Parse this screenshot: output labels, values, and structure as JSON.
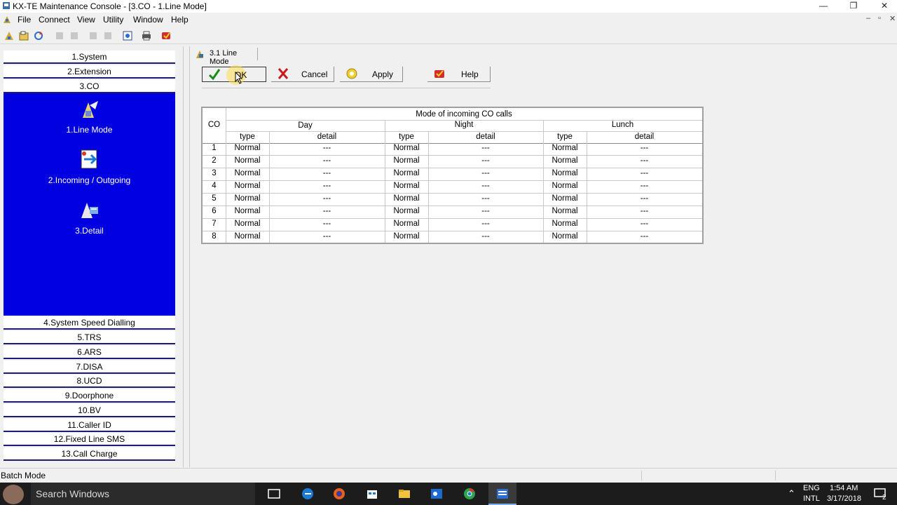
{
  "window": {
    "title": "KX-TE Maintenance Console - [3.CO - 1.Line Mode]",
    "controls": [
      "—",
      "❐",
      "✕"
    ]
  },
  "menubar": {
    "items": [
      "File",
      "Connect",
      "View",
      "Utility",
      "Window",
      "Help"
    ],
    "mdi_controls": [
      "–",
      "▫",
      "✕"
    ]
  },
  "leftnav": {
    "top_items": [
      "1.System",
      "2.Extension",
      "3.CO"
    ],
    "sub_items": [
      "1.Line Mode",
      "2.Incoming / Outgoing",
      "3.Detail"
    ],
    "bottom_items": [
      "4.System Speed Dialling",
      "5.TRS",
      "6.ARS",
      "7.DISA",
      "8.UCD",
      "9.Doorphone",
      "10.BV",
      "11.Caller ID",
      "12.Fixed Line SMS",
      "13.Call Charge"
    ]
  },
  "tab": {
    "label": "3.1 Line Mode"
  },
  "buttons": {
    "ok": "OK",
    "cancel": "Cancel",
    "apply": "Apply",
    "help": "Help"
  },
  "grid": {
    "caption": "Mode of incoming CO calls",
    "co_header": "CO",
    "groups": [
      "Day",
      "Night",
      "Lunch"
    ],
    "sub_headers": [
      "type",
      "detail"
    ],
    "rows": [
      {
        "co": "1",
        "day_type": "Normal",
        "day_detail": "---",
        "night_type": "Normal",
        "night_detail": "---",
        "lunch_type": "Normal",
        "lunch_detail": "---"
      },
      {
        "co": "2",
        "day_type": "Normal",
        "day_detail": "---",
        "night_type": "Normal",
        "night_detail": "---",
        "lunch_type": "Normal",
        "lunch_detail": "---"
      },
      {
        "co": "3",
        "day_type": "Normal",
        "day_detail": "---",
        "night_type": "Normal",
        "night_detail": "---",
        "lunch_type": "Normal",
        "lunch_detail": "---"
      },
      {
        "co": "4",
        "day_type": "Normal",
        "day_detail": "---",
        "night_type": "Normal",
        "night_detail": "---",
        "lunch_type": "Normal",
        "lunch_detail": "---"
      },
      {
        "co": "5",
        "day_type": "Normal",
        "day_detail": "---",
        "night_type": "Normal",
        "night_detail": "---",
        "lunch_type": "Normal",
        "lunch_detail": "---"
      },
      {
        "co": "6",
        "day_type": "Normal",
        "day_detail": "---",
        "night_type": "Normal",
        "night_detail": "---",
        "lunch_type": "Normal",
        "lunch_detail": "---"
      },
      {
        "co": "7",
        "day_type": "Normal",
        "day_detail": "---",
        "night_type": "Normal",
        "night_detail": "---",
        "lunch_type": "Normal",
        "lunch_detail": "---"
      },
      {
        "co": "8",
        "day_type": "Normal",
        "day_detail": "---",
        "night_type": "Normal",
        "night_detail": "---",
        "lunch_type": "Normal",
        "lunch_detail": "---"
      }
    ]
  },
  "statusbar": {
    "text": "Batch Mode"
  },
  "taskbar": {
    "search_placeholder": "Search Windows",
    "lang_top": "ENG",
    "lang_bottom": "INTL",
    "time": "1:54 AM",
    "date": "3/17/2018",
    "notification_count": "2"
  },
  "colors": {
    "nav_blue": "#0000e0",
    "grid_border": "#a0a0a0"
  }
}
